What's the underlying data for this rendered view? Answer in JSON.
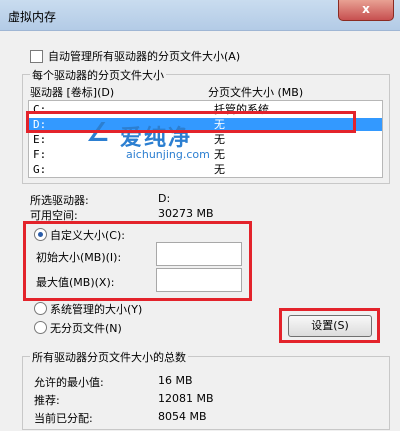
{
  "window": {
    "title": "虚拟内存",
    "close_label": "x"
  },
  "auto_manage": {
    "label": "自动管理所有驱动器的分页文件大小(A)"
  },
  "per_drive": {
    "group_title": "每个驱动器的分页文件大小",
    "header_drive": "驱动器 [卷标](D)",
    "header_size": "分页文件大小 (MB)",
    "rows": [
      {
        "drive": "C:",
        "size": "托管的系统"
      },
      {
        "drive": "D:",
        "size": "无"
      },
      {
        "drive": "E:",
        "size": "无"
      },
      {
        "drive": "F:",
        "size": "无"
      },
      {
        "drive": "G:",
        "size": "无"
      }
    ],
    "selected_index": 1
  },
  "selected_info": {
    "selected_drive_label": "所选驱动器:",
    "selected_drive_value": "D:",
    "free_space_label": "可用空间:",
    "free_space_value": "30273 MB"
  },
  "custom_size": {
    "radio_label": "自定义大小(C):",
    "initial_label": "初始大小(MB)(I):",
    "initial_value": "",
    "max_label": "最大值(MB)(X):",
    "max_value": ""
  },
  "system_managed": {
    "radio_label": "系统管理的大小(Y)"
  },
  "no_paging": {
    "radio_label": "无分页文件(N)"
  },
  "set_button": {
    "label": "设置(S)"
  },
  "totals": {
    "group_title": "所有驱动器分页文件大小的总数",
    "min_label": "允许的最小值:",
    "min_value": "16 MB",
    "recommended_label": "推荐:",
    "recommended_value": "12081 MB",
    "current_label": "当前已分配:",
    "current_value": "8054 MB"
  },
  "watermark": {
    "brand": "爱纯净",
    "url": "aichunjing.com"
  },
  "colors": {
    "highlight": "#3399ff",
    "annotation_red": "#e3232b",
    "watermark": "#2c7fd1"
  }
}
